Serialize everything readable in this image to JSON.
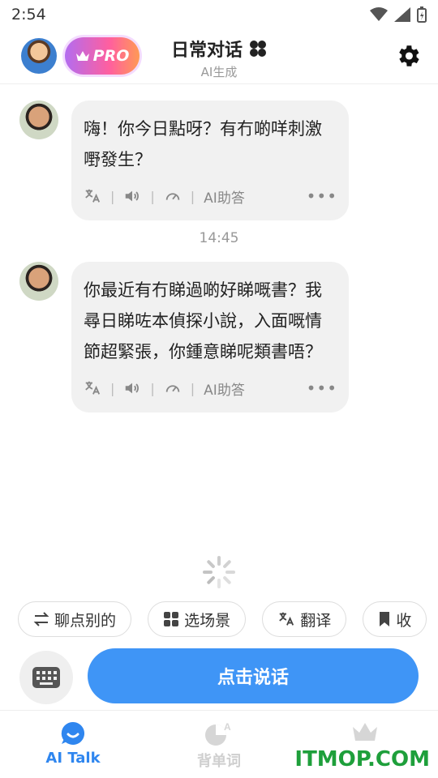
{
  "status": {
    "time": "2:54"
  },
  "header": {
    "pro_label": "PRO",
    "title": "日常对话",
    "subtitle": "AI生成"
  },
  "messages": [
    {
      "text": "嗨！你今日點呀？有冇啲咩刺激嘢發生？",
      "tools": {
        "ai_answer": "AI助答",
        "more": "•••"
      }
    },
    {
      "text": "你最近有冇睇過啲好睇嘅書？我尋日睇咗本偵探小說，入面嘅情節超緊張，你鍾意睇呢類書唔？",
      "tools": {
        "ai_answer": "AI助答",
        "more": "•••"
      }
    }
  ],
  "timestamp": "14:45",
  "chips": [
    {
      "label": "聊点别的",
      "icon": "swap-icon"
    },
    {
      "label": "选场景",
      "icon": "grid-icon"
    },
    {
      "label": "翻译",
      "icon": "translate-icon"
    },
    {
      "label": "收",
      "icon": "bookmark-icon"
    }
  ],
  "input": {
    "talk_label": "点击说话"
  },
  "tabs": [
    {
      "label": "AI Talk",
      "active": true
    },
    {
      "label": "背单词",
      "active": false
    },
    {
      "label": "",
      "active": false
    }
  ],
  "watermark": "ITMOP.COM",
  "colors": {
    "accent": "#3f95f6",
    "tab_active": "#2f86ef",
    "bubble": "#f1f1f1"
  }
}
